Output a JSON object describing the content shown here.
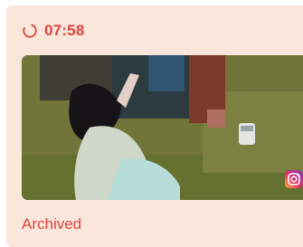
{
  "card": {
    "timer_icon": "loading-ring-icon",
    "time": "07:58",
    "media": {
      "kind": "image",
      "badge_icon": "instagram-icon"
    },
    "status": "Archived"
  },
  "colors": {
    "card_background": "#fbe6dc",
    "accent": "#d9453b"
  }
}
